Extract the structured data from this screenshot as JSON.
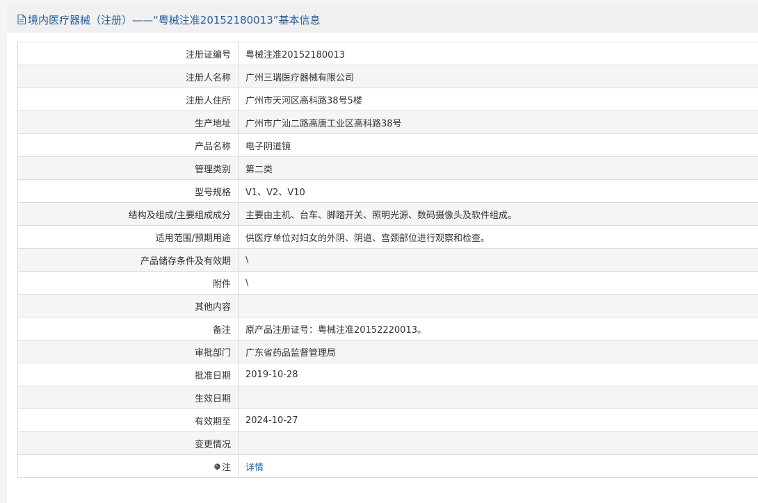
{
  "header": {
    "title": "境内医疗器械（注册）——“粤械注准20152180013”基本信息"
  },
  "rows": [
    {
      "label": "注册证编号",
      "value": "粤械注准20152180013"
    },
    {
      "label": "注册人名称",
      "value": "广州三瑞医疗器械有限公司"
    },
    {
      "label": "注册人住所",
      "value": "广州市天河区高科路38号5楼"
    },
    {
      "label": "生产地址",
      "value": "广州市广汕二路高唐工业区高科路38号"
    },
    {
      "label": "产品名称",
      "value": "电子阴道镜"
    },
    {
      "label": "管理类别",
      "value": "第二类"
    },
    {
      "label": "型号规格",
      "value": "V1、V2、V10"
    },
    {
      "label": "结构及组成/主要组成成分",
      "value": "主要由主机、台车、脚踏开关、照明光源、数码摄像头及软件组成。"
    },
    {
      "label": "适用范围/预期用途",
      "value": "供医疗单位对妇女的外阴、阴道、宫颈部位进行观察和检查。"
    },
    {
      "label": "产品储存条件及有效期",
      "value": "\\"
    },
    {
      "label": "附件",
      "value": "\\"
    },
    {
      "label": "其他内容",
      "value": ""
    },
    {
      "label": "备注",
      "value": "原产品注册证号：粤械注准20152220013。"
    },
    {
      "label": "审批部门",
      "value": "广东省药品监督管理局"
    },
    {
      "label": "批准日期",
      "value": "2019-10-28"
    },
    {
      "label": "生效日期",
      "value": ""
    },
    {
      "label": "有效期至",
      "value": "2024-10-27"
    },
    {
      "label": "变更情况",
      "value": ""
    }
  ],
  "note_row": {
    "label": "注",
    "icon": "comment-bubble-icon",
    "link": "详情"
  },
  "colors": {
    "title": "#1f5fa6",
    "link": "#1f6fc5",
    "border": "#dcdcdc",
    "row_alt": "#f5f5f5"
  }
}
